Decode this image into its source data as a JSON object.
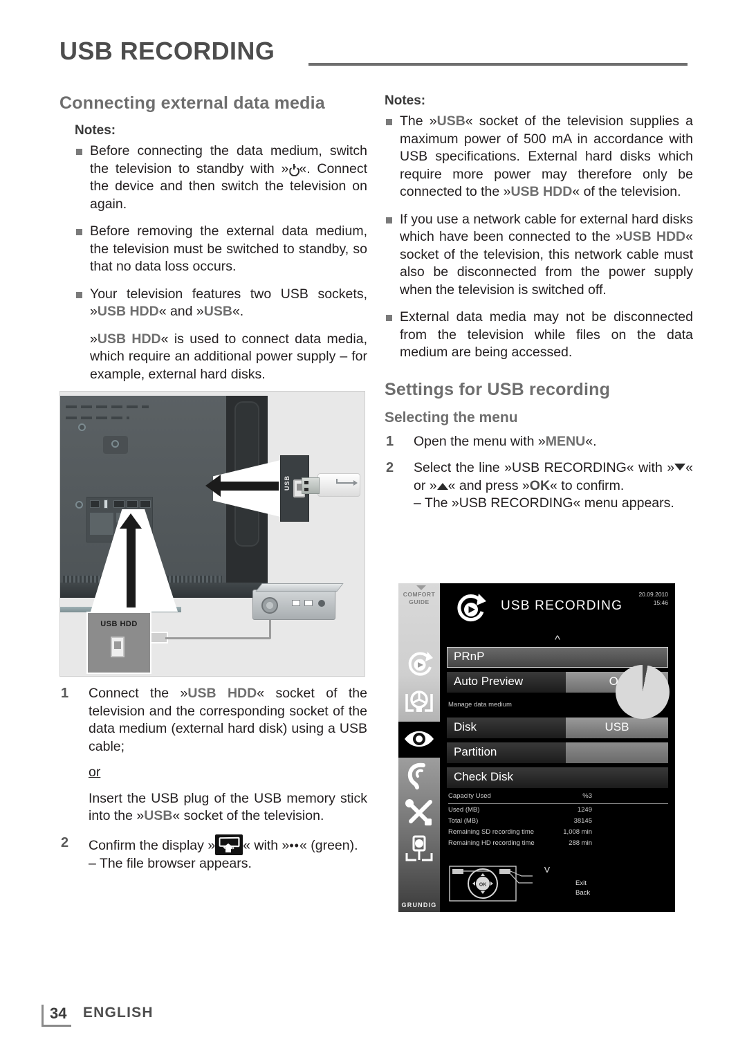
{
  "header": {
    "title": "USB RECORDING"
  },
  "left": {
    "section_title": "Connecting external data media",
    "notes_label": "Notes:",
    "notes": [
      "Before connecting the data medium, switch the television to standby with »⏻«. Connect the device and then switch the television on again.",
      "Before removing the external data medium, the television must be switched to standby, so that no data loss occurs.",
      "Your television features two USB sockets, »USB HDD« and »USB«."
    ],
    "note3_extra": "»USB HDD« is used to connect data media, which require an additional power supply – for example, external hard disks.",
    "note1_a": "Before connecting the data medium, switch the television to standby with »",
    "note1_b": "«. Connect the device and then switch the television on again.",
    "note3_a": "Your television features two USB sockets, »",
    "note3_usbhdd": "USB HDD",
    "note3_b": "« and »",
    "note3_usb": "USB",
    "note3_c": "«.",
    "note3x_a": "»",
    "note3x_bold": "USB HDD",
    "note3x_b": "« is used to connect data media, which require an additional power supply – for example, external hard disks.",
    "steps": [
      {
        "num": "1",
        "a": "Connect the »",
        "bold": "USB HDD",
        "b": "« socket of the television and the corresponding socket of the data medium (external hard disk) using a USB cable;",
        "or": "or",
        "alt_a": "Insert the USB plug of the USB memory stick into the »",
        "alt_bold": "USB",
        "alt_b": "« socket of the television."
      },
      {
        "num": "2",
        "a": "Confirm the display »",
        "icon": "usb-tv-icon",
        "icon_label": "USB",
        "b": "« with »",
        "green_dots": "••",
        "c": "« (green).",
        "dash": "– The file browser appears."
      }
    ]
  },
  "right": {
    "notes_label": "Notes:",
    "note1_a": "The »",
    "note1_usb": "USB",
    "note1_b": "« socket of the television supplies a maximum power of 500 mA in accordance with USB specifications. External hard disks which require more power may therefore only be connected to the »",
    "note1_usbhdd": "USB HDD",
    "note1_c": "« of the television.",
    "note2_a": "If you use a network cable for external hard disks which have been connected to the »",
    "note2_usbhdd": "USB HDD",
    "note2_b": "« socket of the television, this network cable must also be disconnected from the power supply when the television is switched off.",
    "note3": "External data media may not be disconnected from the television while files on the data medium are being accessed.",
    "section_title": "Settings for USB recording",
    "sub_title": "Selecting the menu",
    "step1_a": "Open the menu with »",
    "step1_bold": "MENU",
    "step1_b": "«.",
    "step1_num": "1",
    "step2_num": "2",
    "step2_a": "Select the line »USB RECORDING« with »",
    "step2_b": "« or »",
    "step2_c": "« and press »",
    "step2_ok": "OK",
    "step2_d": "« to confirm.",
    "step2_dash": "– The »USB RECORDING« menu appears."
  },
  "diagram": {
    "usb_socket_label": "USB",
    "usb_hdd_label": "USB HDD"
  },
  "osd": {
    "sidebar": {
      "comfort_guide": "COMFORT\nGUIDE",
      "comfort_line1": "COMFORT",
      "comfort_line2": "GUIDE",
      "brand": "GRUNDIG",
      "icons": [
        "usb-recording-icon",
        "media-source-icon",
        "picture-eye-icon",
        "sound-ear-icon",
        "settings-tools-icon",
        "network-icon"
      ]
    },
    "title": "USB RECORDING",
    "date": "20.09.2010",
    "time": "15:46",
    "rows": [
      {
        "label": "PRnP",
        "value": "",
        "selected": true
      },
      {
        "label": "Auto Preview",
        "value": "On",
        "selected": false
      }
    ],
    "manage_label": "Manage data medium",
    "rows2": [
      {
        "label": "Disk",
        "value": "USB"
      },
      {
        "label": "Partition",
        "value": ""
      }
    ],
    "check_disk": "Check Disk",
    "stats": [
      {
        "key": "Capacity Used",
        "value": "%3"
      },
      {
        "key": "Used (MB)",
        "value": "1249"
      },
      {
        "key": "Total (MB)",
        "value": "38145"
      },
      {
        "key": "Remaining SD recording time",
        "value": "1,008 min"
      },
      {
        "key": "Remaining HD recording time",
        "value": "288 min"
      }
    ],
    "nav": {
      "exit": "Exit",
      "back": "Back",
      "ok": "OK"
    }
  },
  "footer": {
    "page": "34",
    "language": "ENGLISH"
  }
}
